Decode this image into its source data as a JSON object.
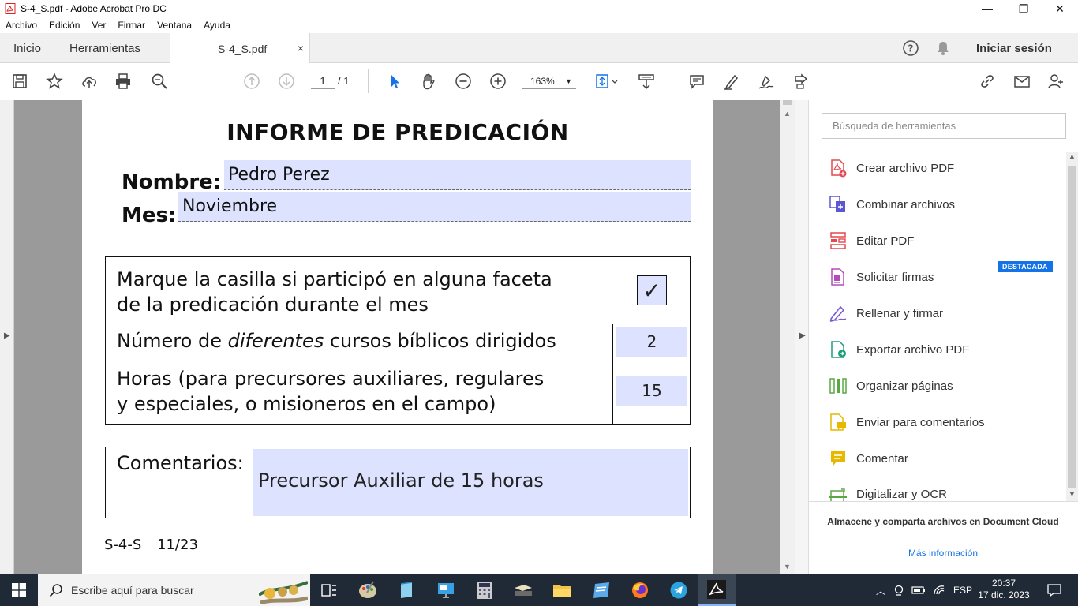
{
  "window": {
    "title": "S-4_S.pdf - Adobe Acrobat Pro DC",
    "minimize": "—",
    "restore": "❐",
    "close": "✕"
  },
  "menu": [
    "Archivo",
    "Edición",
    "Ver",
    "Firmar",
    "Ventana",
    "Ayuda"
  ],
  "tabs": {
    "home": "Inicio",
    "tools": "Herramientas",
    "document": "S-4_S.pdf",
    "close": "×",
    "signin": "Iniciar sesión"
  },
  "toolbar": {
    "page_current": "1",
    "page_total": "/ 1",
    "zoom": "163%",
    "zoom_caret": "▼"
  },
  "document": {
    "title": "INFORME DE PREDICACIÓN",
    "name_label": "Nombre:",
    "name_value": "Pedro Perez",
    "month_label": "Mes:",
    "month_value": "Noviembre",
    "row1_line1": "Marque la casilla si participó en alguna faceta",
    "row1_line2": "de la predicación durante el mes",
    "row1_check": "✓",
    "row2_pre": "Número de ",
    "row2_em": "diferentes",
    "row2_post": " cursos bíblicos dirigidos",
    "row2_value": "2",
    "row3_line1": "Horas (para precursores auxiliares, regulares",
    "row3_line2": "y especiales, o misioneros en el campo)",
    "row3_value": "15",
    "comments_label": "Comentarios:",
    "comments_value": "Precursor Auxiliar de 15 horas",
    "footer_code": "S-4-S",
    "footer_date": "11/23"
  },
  "right_panel": {
    "search_placeholder": "Búsqueda de herramientas",
    "tools": [
      {
        "label": "Crear archivo PDF",
        "icon": "create-pdf-icon",
        "color": "#e34850"
      },
      {
        "label": "Combinar archivos",
        "icon": "combine-files-icon",
        "color": "#5b57d1"
      },
      {
        "label": "Editar PDF",
        "icon": "edit-pdf-icon",
        "color": "#e34850"
      },
      {
        "label": "Solicitar firmas",
        "icon": "request-signatures-icon",
        "color": "#b34bb8"
      },
      {
        "label": "Rellenar y firmar",
        "icon": "fill-sign-icon",
        "color": "#7b5bd1"
      },
      {
        "label": "Exportar archivo PDF",
        "icon": "export-pdf-icon",
        "color": "#1f9e7a"
      },
      {
        "label": "Organizar páginas",
        "icon": "organize-pages-icon",
        "color": "#5aa845"
      },
      {
        "label": "Enviar para comentarios",
        "icon": "send-comments-icon",
        "color": "#e6b800"
      },
      {
        "label": "Comentar",
        "icon": "comment-icon",
        "color": "#e6b800"
      },
      {
        "label": "Digitalizar y OCR",
        "icon": "scan-ocr-icon",
        "color": "#5aa845"
      }
    ],
    "badge": "DESTACADA",
    "cloud_text": "Almacene y comparta archivos en Document Cloud",
    "cloud_link": "Más información"
  },
  "taskbar": {
    "search_placeholder": "Escribe aquí para buscar",
    "language": "ESP",
    "time": "20:37",
    "date": "17 dic. 2023"
  },
  "colors": {
    "field_bg": "#dde3ff",
    "accent": "#1473e6",
    "taskbar": "#1f2a36"
  }
}
